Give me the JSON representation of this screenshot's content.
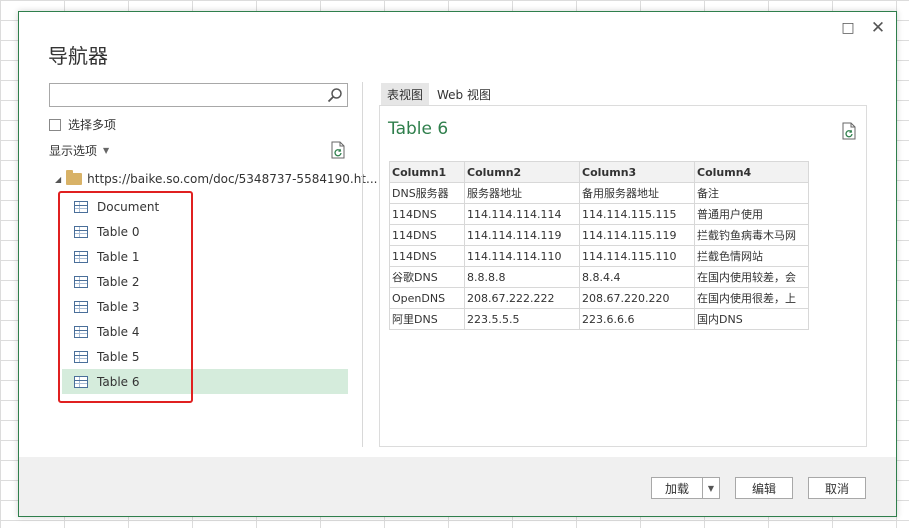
{
  "dialog": {
    "title": "导航器"
  },
  "window": {
    "maximize": "□",
    "close": "✕"
  },
  "left": {
    "search": {
      "value": "",
      "placeholder": ""
    },
    "multi_select_label": "选择多项",
    "display_options_label": "显示选项",
    "tree": {
      "root_label": "https://baike.so.com/doc/5348737-5584190.ht...",
      "items": [
        {
          "label": "Document"
        },
        {
          "label": "Table 0"
        },
        {
          "label": "Table 1"
        },
        {
          "label": "Table 2"
        },
        {
          "label": "Table 3"
        },
        {
          "label": "Table 4"
        },
        {
          "label": "Table 5"
        },
        {
          "label": "Table 6"
        }
      ],
      "selected": "Table 6"
    }
  },
  "right": {
    "tabs": [
      {
        "label": "表视图"
      },
      {
        "label": "Web 视图"
      }
    ],
    "active_tab": "表视图",
    "preview_title": "Table 6",
    "table": {
      "headers": [
        "Column1",
        "Column2",
        "Column3",
        "Column4"
      ],
      "rows": [
        [
          "DNS服务器",
          "服务器地址",
          "备用服务器地址",
          "备注"
        ],
        [
          "114DNS",
          "114.114.114.114",
          "114.114.115.115",
          "普通用户使用"
        ],
        [
          "114DNS",
          "114.114.114.119",
          "114.114.115.119",
          "拦截钓鱼病毒木马网"
        ],
        [
          "114DNS",
          "114.114.114.110",
          "114.114.115.110",
          "拦截色情网站"
        ],
        [
          "谷歌DNS",
          "8.8.8.8",
          "8.8.4.4",
          "在国内使用较差，会"
        ],
        [
          "OpenDNS",
          "208.67.222.222",
          "208.67.220.220",
          "在国内使用很差，上"
        ],
        [
          "阿里DNS",
          "223.5.5.5",
          "223.6.6.6",
          "国内DNS"
        ]
      ]
    }
  },
  "footer": {
    "load_label": "加载",
    "load_dropdown": "▼",
    "edit_label": "编辑",
    "cancel_label": "取消"
  },
  "colors": {
    "accent": "#2f7f4c",
    "selection": "#d5ecdc",
    "annotation_box": "#e02020"
  }
}
